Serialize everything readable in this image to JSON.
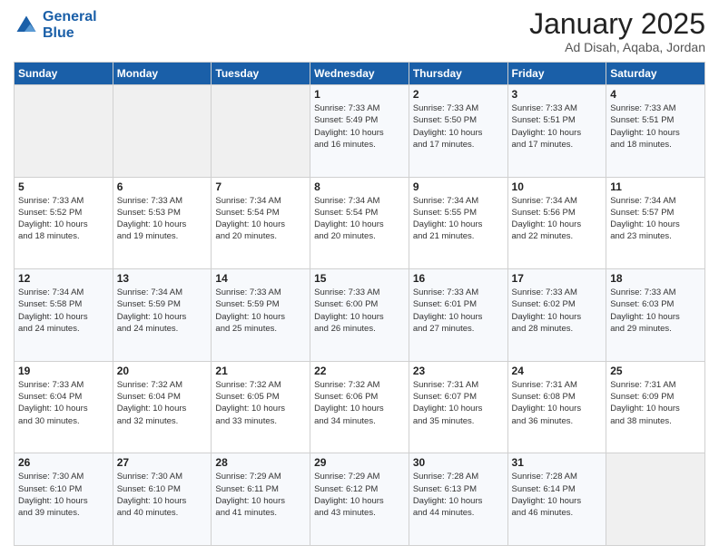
{
  "header": {
    "logo_line1": "General",
    "logo_line2": "Blue",
    "month_title": "January 2025",
    "location": "Ad Disah, Aqaba, Jordan"
  },
  "weekdays": [
    "Sunday",
    "Monday",
    "Tuesday",
    "Wednesday",
    "Thursday",
    "Friday",
    "Saturday"
  ],
  "weeks": [
    [
      {
        "day": "",
        "info": ""
      },
      {
        "day": "",
        "info": ""
      },
      {
        "day": "",
        "info": ""
      },
      {
        "day": "1",
        "info": "Sunrise: 7:33 AM\nSunset: 5:49 PM\nDaylight: 10 hours\nand 16 minutes."
      },
      {
        "day": "2",
        "info": "Sunrise: 7:33 AM\nSunset: 5:50 PM\nDaylight: 10 hours\nand 17 minutes."
      },
      {
        "day": "3",
        "info": "Sunrise: 7:33 AM\nSunset: 5:51 PM\nDaylight: 10 hours\nand 17 minutes."
      },
      {
        "day": "4",
        "info": "Sunrise: 7:33 AM\nSunset: 5:51 PM\nDaylight: 10 hours\nand 18 minutes."
      }
    ],
    [
      {
        "day": "5",
        "info": "Sunrise: 7:33 AM\nSunset: 5:52 PM\nDaylight: 10 hours\nand 18 minutes."
      },
      {
        "day": "6",
        "info": "Sunrise: 7:33 AM\nSunset: 5:53 PM\nDaylight: 10 hours\nand 19 minutes."
      },
      {
        "day": "7",
        "info": "Sunrise: 7:34 AM\nSunset: 5:54 PM\nDaylight: 10 hours\nand 20 minutes."
      },
      {
        "day": "8",
        "info": "Sunrise: 7:34 AM\nSunset: 5:54 PM\nDaylight: 10 hours\nand 20 minutes."
      },
      {
        "day": "9",
        "info": "Sunrise: 7:34 AM\nSunset: 5:55 PM\nDaylight: 10 hours\nand 21 minutes."
      },
      {
        "day": "10",
        "info": "Sunrise: 7:34 AM\nSunset: 5:56 PM\nDaylight: 10 hours\nand 22 minutes."
      },
      {
        "day": "11",
        "info": "Sunrise: 7:34 AM\nSunset: 5:57 PM\nDaylight: 10 hours\nand 23 minutes."
      }
    ],
    [
      {
        "day": "12",
        "info": "Sunrise: 7:34 AM\nSunset: 5:58 PM\nDaylight: 10 hours\nand 24 minutes."
      },
      {
        "day": "13",
        "info": "Sunrise: 7:34 AM\nSunset: 5:59 PM\nDaylight: 10 hours\nand 24 minutes."
      },
      {
        "day": "14",
        "info": "Sunrise: 7:33 AM\nSunset: 5:59 PM\nDaylight: 10 hours\nand 25 minutes."
      },
      {
        "day": "15",
        "info": "Sunrise: 7:33 AM\nSunset: 6:00 PM\nDaylight: 10 hours\nand 26 minutes."
      },
      {
        "day": "16",
        "info": "Sunrise: 7:33 AM\nSunset: 6:01 PM\nDaylight: 10 hours\nand 27 minutes."
      },
      {
        "day": "17",
        "info": "Sunrise: 7:33 AM\nSunset: 6:02 PM\nDaylight: 10 hours\nand 28 minutes."
      },
      {
        "day": "18",
        "info": "Sunrise: 7:33 AM\nSunset: 6:03 PM\nDaylight: 10 hours\nand 29 minutes."
      }
    ],
    [
      {
        "day": "19",
        "info": "Sunrise: 7:33 AM\nSunset: 6:04 PM\nDaylight: 10 hours\nand 30 minutes."
      },
      {
        "day": "20",
        "info": "Sunrise: 7:32 AM\nSunset: 6:04 PM\nDaylight: 10 hours\nand 32 minutes."
      },
      {
        "day": "21",
        "info": "Sunrise: 7:32 AM\nSunset: 6:05 PM\nDaylight: 10 hours\nand 33 minutes."
      },
      {
        "day": "22",
        "info": "Sunrise: 7:32 AM\nSunset: 6:06 PM\nDaylight: 10 hours\nand 34 minutes."
      },
      {
        "day": "23",
        "info": "Sunrise: 7:31 AM\nSunset: 6:07 PM\nDaylight: 10 hours\nand 35 minutes."
      },
      {
        "day": "24",
        "info": "Sunrise: 7:31 AM\nSunset: 6:08 PM\nDaylight: 10 hours\nand 36 minutes."
      },
      {
        "day": "25",
        "info": "Sunrise: 7:31 AM\nSunset: 6:09 PM\nDaylight: 10 hours\nand 38 minutes."
      }
    ],
    [
      {
        "day": "26",
        "info": "Sunrise: 7:30 AM\nSunset: 6:10 PM\nDaylight: 10 hours\nand 39 minutes."
      },
      {
        "day": "27",
        "info": "Sunrise: 7:30 AM\nSunset: 6:10 PM\nDaylight: 10 hours\nand 40 minutes."
      },
      {
        "day": "28",
        "info": "Sunrise: 7:29 AM\nSunset: 6:11 PM\nDaylight: 10 hours\nand 41 minutes."
      },
      {
        "day": "29",
        "info": "Sunrise: 7:29 AM\nSunset: 6:12 PM\nDaylight: 10 hours\nand 43 minutes."
      },
      {
        "day": "30",
        "info": "Sunrise: 7:28 AM\nSunset: 6:13 PM\nDaylight: 10 hours\nand 44 minutes."
      },
      {
        "day": "31",
        "info": "Sunrise: 7:28 AM\nSunset: 6:14 PM\nDaylight: 10 hours\nand 46 minutes."
      },
      {
        "day": "",
        "info": ""
      }
    ]
  ]
}
